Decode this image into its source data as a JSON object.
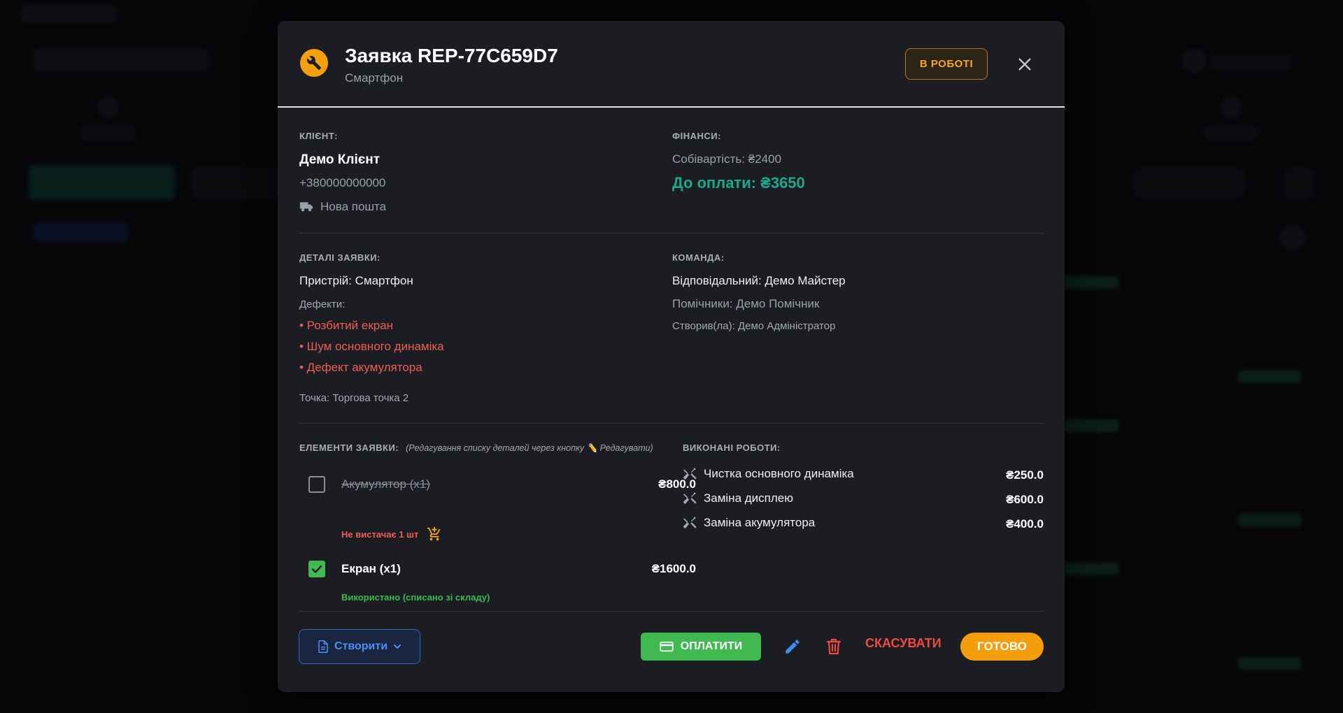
{
  "header": {
    "title": "Заявка REP-77C659D7",
    "subtitle": "Смартфон",
    "status": "В РОБОТІ"
  },
  "client": {
    "label": "КЛІЄНТ:",
    "name": "Демо Клієнт",
    "phone": "+380000000000",
    "delivery": "Нова пошта"
  },
  "finance": {
    "label": "ФІНАНСИ:",
    "cost": "Собівартість: ₴2400",
    "due": "До оплати: ₴3650"
  },
  "details": {
    "label": "ДЕТАЛІ ЗАЯВКИ:",
    "device": "Пристрій: Смартфон",
    "defects_label": "Дефекти:",
    "defects": [
      "• Розбитий екран",
      "• Шум основного динаміка",
      "• Дефект акумулятора"
    ],
    "point": "Точка: Торгова точка 2"
  },
  "team": {
    "label": "КОМАНДА:",
    "responsible": "Відповідальний: Демо Майстер",
    "helpers": "Помічники: Демо Помічник",
    "creator": "Створив(ла): Демо Адміністратор"
  },
  "items": {
    "label": "ЕЛЕМЕНТИ ЗАЯВКИ:",
    "note": "(Редагування списку деталей через кнопку ✏️ Редагувати)",
    "list": [
      {
        "name": "Акумулятор (x1)",
        "price": "₴800.0",
        "checked": false,
        "status": "Не вистачає 1 шт"
      },
      {
        "name": "Екран (x1)",
        "price": "₴1600.0",
        "checked": true,
        "status": "Використано (списано зі складу)"
      }
    ]
  },
  "works": {
    "label": "ВИКОНАНІ РОБОТИ:",
    "list": [
      {
        "name": "Чистка основного динаміка",
        "price": "₴250.0"
      },
      {
        "name": "Заміна дисплею",
        "price": "₴600.0"
      },
      {
        "name": "Заміна акумулятора",
        "price": "₴400.0"
      }
    ]
  },
  "actions": {
    "create": "Створити",
    "pay": "ОПЛАТИТИ",
    "cancel": "СКАСУВАТИ",
    "done": "ГОТОВО"
  },
  "colors": {
    "accent_orange": "#f59e0b",
    "success_green": "#3fb950",
    "danger_red": "#ef5d55",
    "due_teal": "#1aa88e",
    "link_blue": "#4e8ff3"
  }
}
